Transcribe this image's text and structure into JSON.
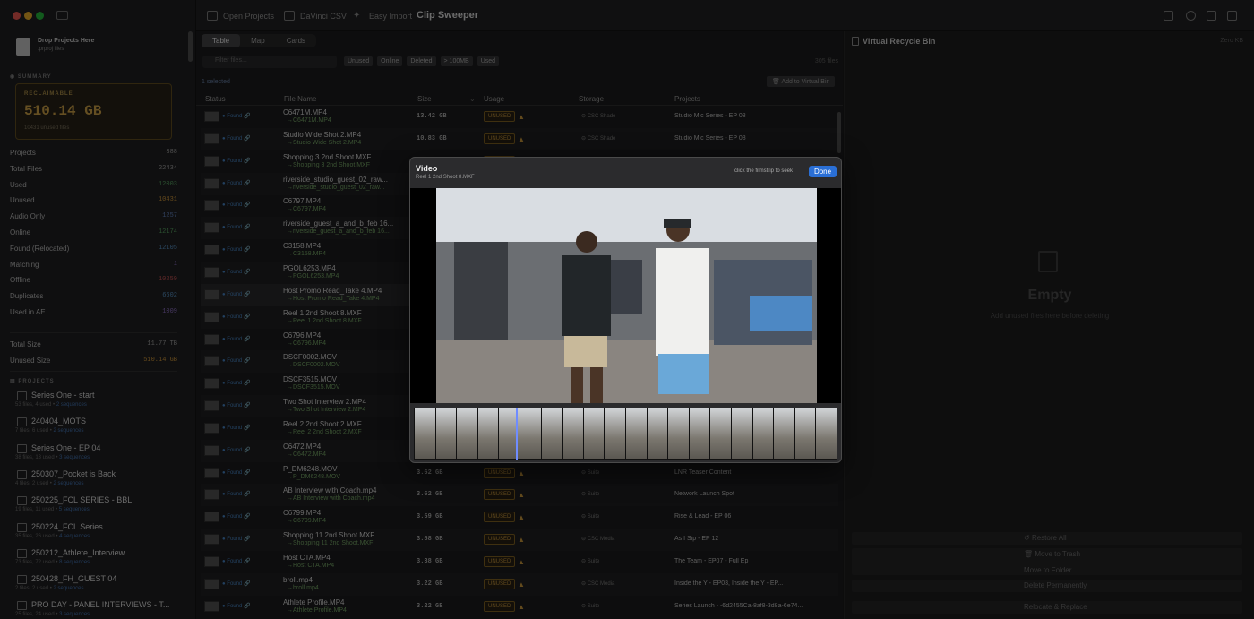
{
  "sidebar": {
    "drop_title": "Drop Projects Here",
    "drop_sub": ".prproj files",
    "summary_head": "SUMMARY",
    "reclaim_label": "RECLAIMABLE",
    "reclaim_value": "510.14 GB",
    "reclaim_sub": "10431 unused files",
    "stats": [
      {
        "label": "Projects",
        "value": "388",
        "color": "#b0b0b0"
      },
      {
        "label": "Total Files",
        "value": "22434",
        "color": "#b0b0b0"
      },
      {
        "label": "Used",
        "value": "12003",
        "color": "#5fb36a"
      },
      {
        "label": "Unused",
        "value": "10431",
        "color": "#e0a33f"
      },
      {
        "label": "Audio Only",
        "value": "1257",
        "color": "#6a8fd0"
      },
      {
        "label": "Online",
        "value": "12174",
        "color": "#5fb36a"
      },
      {
        "label": "Found (Relocated)",
        "value": "12105",
        "color": "#5f9fd6"
      },
      {
        "label": "Matching",
        "value": "1",
        "color": "#9c7bd6"
      },
      {
        "label": "Offline",
        "value": "10259",
        "color": "#d65a5a"
      },
      {
        "label": "Duplicates",
        "value": "6602",
        "color": "#5f9fd6"
      },
      {
        "label": "Used in AE",
        "value": "1009",
        "color": "#9c7bd6"
      }
    ],
    "total_size_label": "Total Size",
    "total_size_value": "11.77 TB",
    "unused_size_label": "Unused Size",
    "unused_size_value": "510.14 GB",
    "projects_head": "PROJECTS",
    "projects": [
      {
        "name": "Series One - start",
        "meta": "53 files, 4 used •",
        "seq": "2 sequences"
      },
      {
        "name": "240404_MOTS",
        "meta": "7 files, 6 used •",
        "seq": "2 sequences"
      },
      {
        "name": "Series One - EP 04",
        "meta": "38 files, 13 used •",
        "seq": "3 sequences"
      },
      {
        "name": "250307_Pocket is Back",
        "meta": "4 files, 2 used •",
        "seq": "2 sequences"
      },
      {
        "name": "250225_FCL SERIES - BBL",
        "meta": "19 files, 11 used •",
        "seq": "5 sequences"
      },
      {
        "name": "250224_FCL Series",
        "meta": "35 files, 26 used •",
        "seq": "4 sequences"
      },
      {
        "name": "250212_Athlete_Interview",
        "meta": "73 files, 72 used •",
        "seq": "8 sequences"
      },
      {
        "name": "250428_FH_GUEST 04",
        "meta": "2 files, 2 used •",
        "seq": "2 sequences"
      },
      {
        "name": "PRO DAY - PANEL INTERVIEWS - T...",
        "meta": "25 files, 24 used •",
        "seq": "3 sequences"
      }
    ]
  },
  "toolbar": {
    "open_projects": "Open Projects",
    "davinci_csv": "DaVinci CSV",
    "easy_import": "Easy Import",
    "title": "Clip Sweeper"
  },
  "main": {
    "tabs": [
      "Table",
      "Map",
      "Cards"
    ],
    "filter_placeholder": "Filter files...",
    "chips": [
      "Unused",
      "Online",
      "Deleted",
      "> 100MB",
      "Used"
    ],
    "file_count": "305 files",
    "selected": "1 selected",
    "add_to_bin": "Add to Virtual Bin",
    "columns": [
      "Status",
      "File Name",
      "Size",
      "Usage",
      "Storage",
      "Projects"
    ],
    "found_label": "Found",
    "unused_label": "UNUSED",
    "rows": [
      {
        "name": "C6471M.MP4",
        "sub": "→C6471M.MP4",
        "size": "13.42 GB",
        "storage": "CSC Shade",
        "project": "Studio Mic Series - EP 08"
      },
      {
        "name": "Studio Wide Shot 2.MP4",
        "sub": "→Studio Wide Shot 2.MP4",
        "size": "10.83 GB",
        "storage": "CSC Shade",
        "project": "Studio Mic Series - EP 08"
      },
      {
        "name": "Shopping 3 2nd Shoot.MXF",
        "sub": "→Shopping 3 2nd Shoot.MXF",
        "size": "",
        "storage": "",
        "project": ""
      },
      {
        "name": "riverside_studio_guest_02_raw...",
        "sub": "→riverside_studio_guest_02_raw...",
        "size": "",
        "storage": "",
        "project": ""
      },
      {
        "name": "C6797.MP4",
        "sub": "→C6797.MP4",
        "size": "",
        "storage": "",
        "project": ""
      },
      {
        "name": "riverside_guest_a_and_b_feb 16...",
        "sub": "→riverside_guest_a_and_b_feb 16...",
        "size": "",
        "storage": "",
        "project": ""
      },
      {
        "name": "C3158.MP4",
        "sub": "→C3158.MP4",
        "size": "",
        "storage": "",
        "project": ""
      },
      {
        "name": "PGOL6253.MP4",
        "sub": "→PGOL6253.MP4",
        "size": "",
        "storage": "",
        "project": ""
      },
      {
        "name": "Host Promo Read_Take 4.MP4",
        "sub": "→Host Promo Read_Take 4.MP4",
        "size": "",
        "storage": "",
        "project": ""
      },
      {
        "name": "Reel 1 2nd Shoot 8.MXF",
        "sub": "→Reel 1 2nd Shoot 8.MXF",
        "size": "",
        "storage": "",
        "project": ""
      },
      {
        "name": "C6796.MP4",
        "sub": "→C6796.MP4",
        "size": "",
        "storage": "",
        "project": ""
      },
      {
        "name": "DSCF0002.MOV",
        "sub": "→DSCF0002.MOV",
        "size": "",
        "storage": "",
        "project": ""
      },
      {
        "name": "DSCF3515.MOV",
        "sub": "→DSCF3515.MOV",
        "size": "",
        "storage": "",
        "project": ""
      },
      {
        "name": "Two Shot Interview 2.MP4",
        "sub": "→Two Shot Interview 2.MP4",
        "size": "",
        "storage": "",
        "project": ""
      },
      {
        "name": "Reel 2 2nd Shoot 2.MXF",
        "sub": "→Reel 2 2nd Shoot 2.MXF",
        "size": "",
        "storage": "",
        "project": ""
      },
      {
        "name": "C6472.MP4",
        "sub": "→C6472.MP4",
        "size": "",
        "storage": "",
        "project": ""
      },
      {
        "name": "P_DM6248.MOV",
        "sub": "→P_DM6248.MOV",
        "size": "3.62 GB",
        "storage": "Suite",
        "project": "LNR Teaser Content"
      },
      {
        "name": "AB Interview with Coach.mp4",
        "sub": "→AB Interview with Coach.mp4",
        "size": "3.62 GB",
        "storage": "Suite",
        "project": "Network Launch Spot"
      },
      {
        "name": "C6799.MP4",
        "sub": "→C6799.MP4",
        "size": "3.59 GB",
        "storage": "Suite",
        "project": "Rise & Lead - EP 06"
      },
      {
        "name": "Shopping 11 2nd Shoot.MXF",
        "sub": "→Shopping 11 2nd Shoot.MXF",
        "size": "3.58 GB",
        "storage": "CSC Media",
        "project": "As I Sip - EP 12"
      },
      {
        "name": "Host CTA.MP4",
        "sub": "→Host CTA.MP4",
        "size": "3.38 GB",
        "storage": "Suite",
        "project": "The Team - EP07 - Full Ep"
      },
      {
        "name": "broll.mp4",
        "sub": "→broll.mp4",
        "size": "3.22 GB",
        "storage": "CSC Media",
        "project": "Inside the Y - EP03, Inside the Y - EP..."
      },
      {
        "name": "Athlete Profile.MP4",
        "sub": "→Athlete Profile.MP4",
        "size": "3.22 GB",
        "storage": "Suite",
        "project": "Series Launch - -6d2455Ca-8af8-3d8a-6e74..."
      }
    ]
  },
  "rpanel": {
    "title": "Virtual Recycle Bin",
    "zero": "Zero KB",
    "empty": "Empty",
    "hint": "Add unused files here before deleting",
    "restore": "Restore All",
    "move_trash": "Move to Trash",
    "move_folder": "Move to Folder...",
    "delete_perm": "Delete Permanently",
    "relocate": "Relocate & Replace"
  },
  "modal": {
    "title": "Video",
    "subtitle": "Reel 1 2nd Shoot 8.MXF",
    "hint": "click the filmstrip to seek",
    "done": "Done"
  }
}
